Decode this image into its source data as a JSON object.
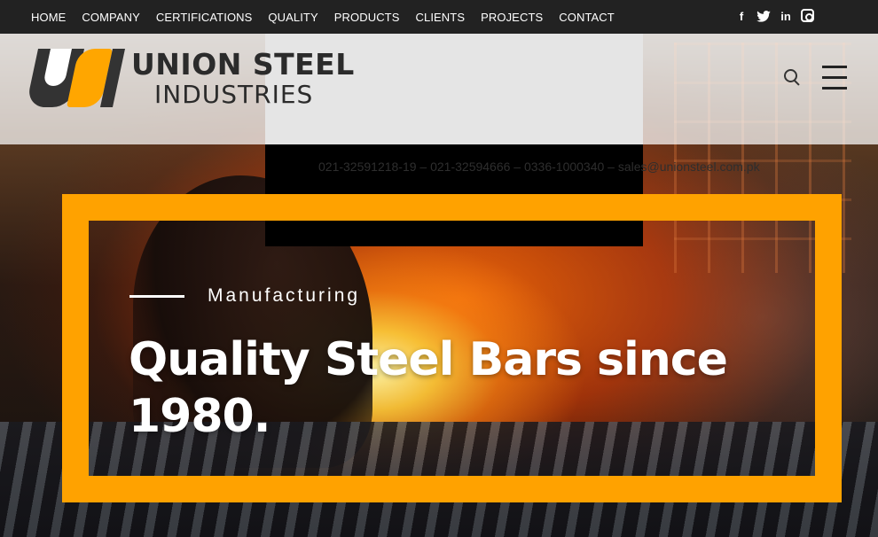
{
  "nav": {
    "items": [
      "HOME",
      "COMPANY",
      "CERTIFICATIONS",
      "QUALITY",
      "PRODUCTS",
      "CLIENTS",
      "PROJECTS",
      "CONTACT"
    ]
  },
  "social": {
    "facebook": "f",
    "twitter": "🐦",
    "linkedin": "in",
    "instagram": ""
  },
  "logo": {
    "line1": "UNION STEEL",
    "line2": "INDUSTRIES",
    "accent": "#ffa600",
    "dark": "#333333"
  },
  "contact": {
    "text": "021-32591218-19 – 021-32594666 – 0336-1000340 – sales@unionsteel.com.pk"
  },
  "hero": {
    "kicker": "Manufacturing",
    "headline": "Quality Steel Bars since 1980.",
    "frame_color": "#ffa200"
  }
}
